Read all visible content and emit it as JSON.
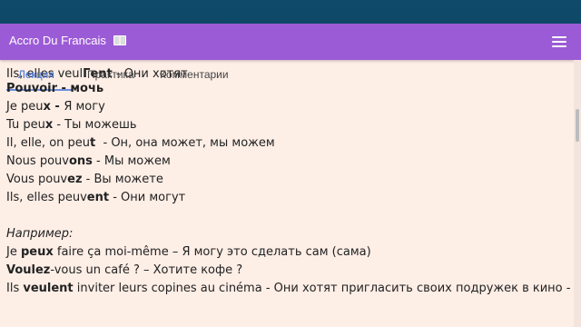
{
  "app": {
    "title": "Accro Du Francais",
    "title_icon": "book-icon",
    "menu_icon": "hamburger-menu-icon",
    "accent_color": "#9c5bd6",
    "background_color": "#fdeee6"
  },
  "overlap_text": {
    "part1": "Ils, elles veul",
    "part2": "Гent",
    "part3": " - Они хотят"
  },
  "tabs": [
    {
      "label": "Лекция",
      "active": true
    },
    {
      "label": "Практика",
      "active": false
    },
    {
      "label": "Комментарии",
      "active": false
    }
  ],
  "lesson": {
    "heading_bold": "Pouvoir - мочь",
    "conjugations": [
      {
        "prefix": "Je peu",
        "ending": "x - ",
        "translation": "Я могу"
      },
      {
        "prefix": "Tu peu",
        "ending": "x",
        "translation": " - Ты можешь"
      },
      {
        "prefix": "Il, elle, on peu",
        "ending": "t",
        "translation": "  - Он, она может, мы можем"
      },
      {
        "prefix": "Nous pouv",
        "ending": "ons",
        "translation": " - Мы можем"
      },
      {
        "prefix": "Vous pouv",
        "ending": "ez",
        "translation": " - Вы можете"
      },
      {
        "prefix": "Ils, elles peuv",
        "ending": "ent",
        "translation": " - Они могут"
      }
    ],
    "examples_label": "Например:",
    "examples": [
      {
        "pre": "Je ",
        "bold": "peux",
        "post": " faire ça moi-même – Я могу это сделать сам (сама)"
      },
      {
        "pre": "",
        "bold": "Voulez",
        "post": "-vous un café ? – Хотите кофе ?"
      },
      {
        "pre": "Ils ",
        "bold": "veulent",
        "post": " inviter leurs copines au cinéma - Они хотят пригласить своих подружек в кино -"
      }
    ]
  }
}
